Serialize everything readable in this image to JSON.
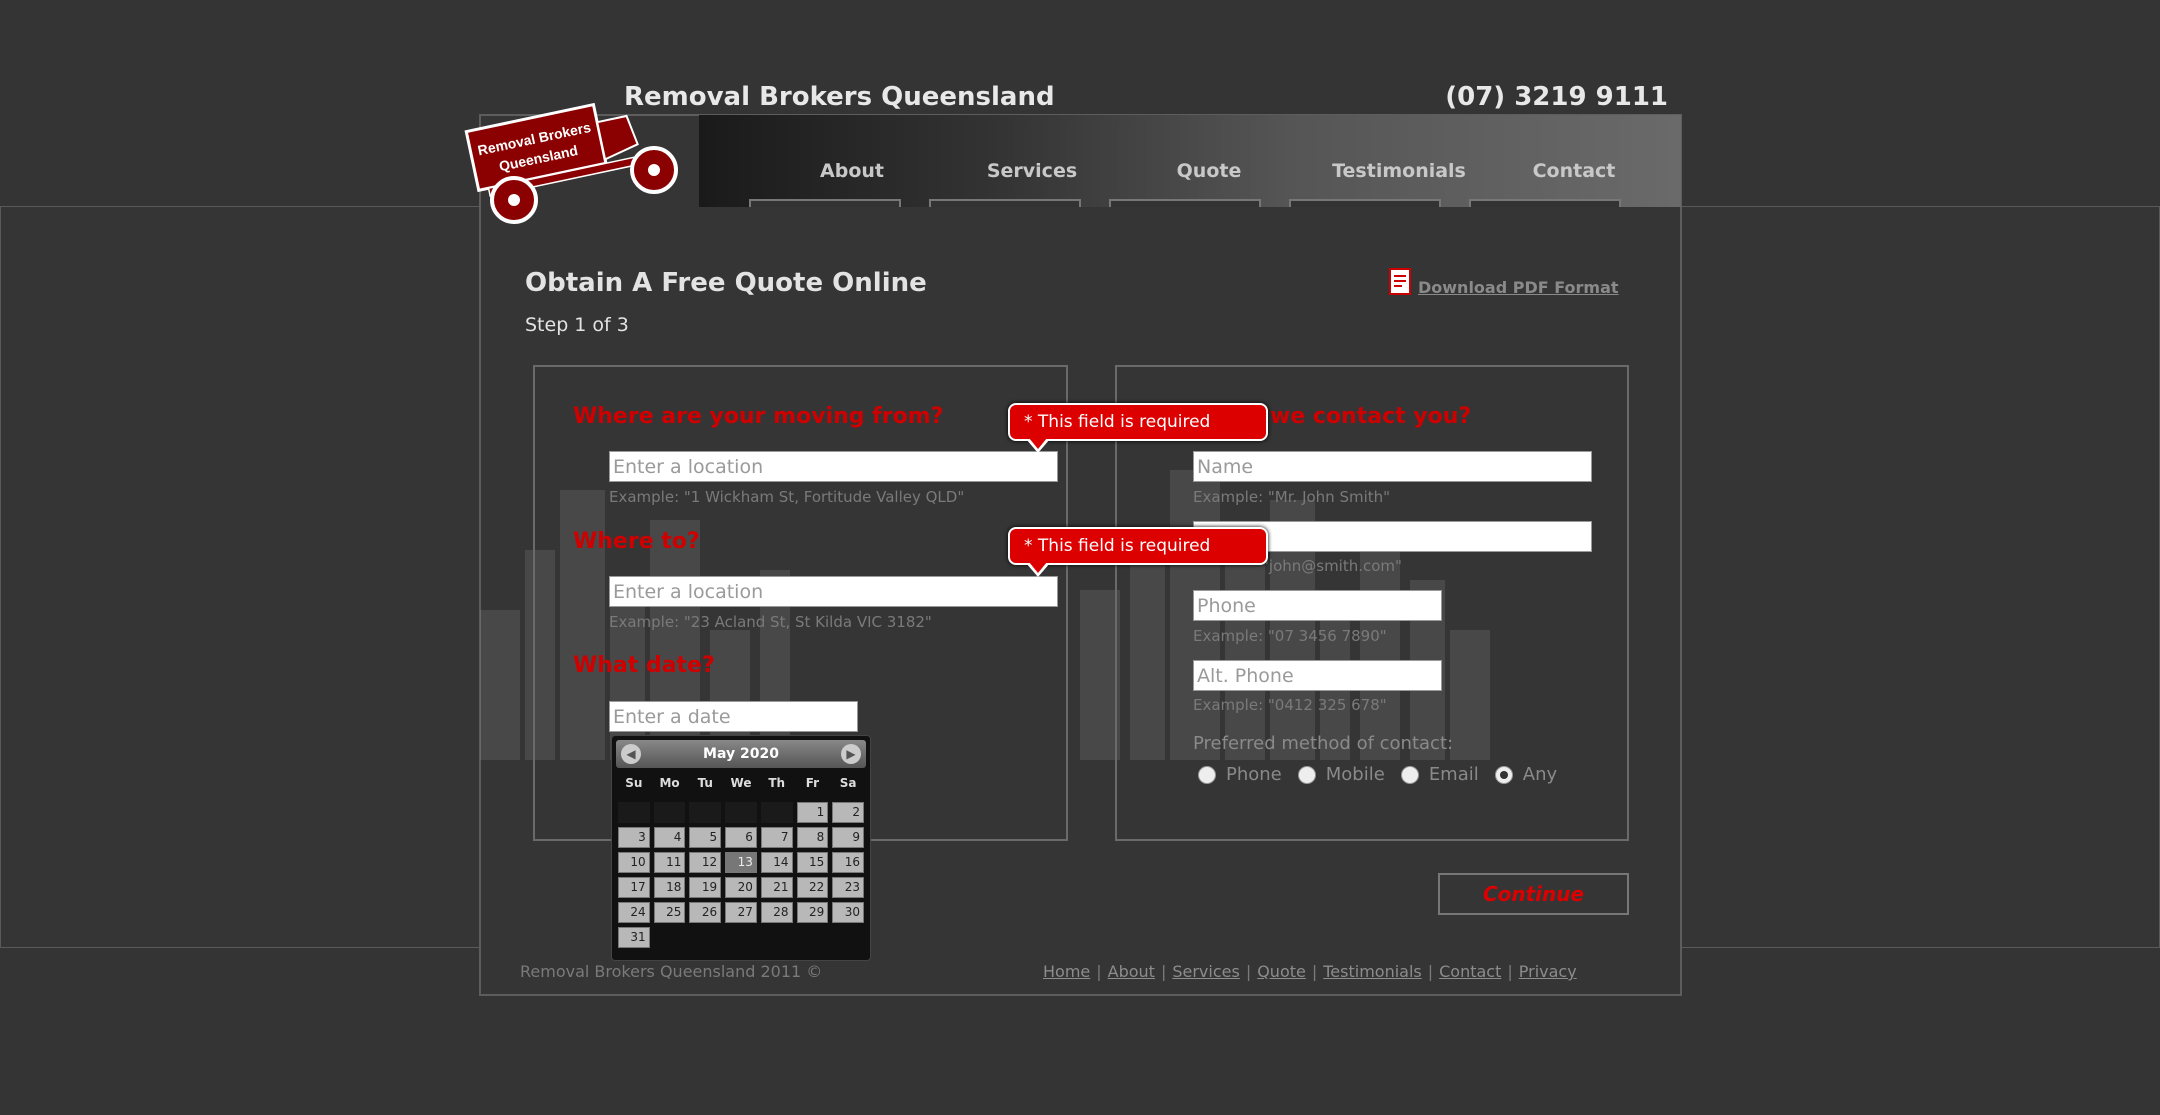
{
  "header": {
    "title": "Removal Brokers Queensland",
    "phone": "(07) 3219 9111",
    "logo_text": "Removal Brokers Queensland"
  },
  "nav": {
    "items": [
      "About",
      "Services",
      "Quote",
      "Testimonials",
      "Contact"
    ]
  },
  "page": {
    "title": "Obtain A Free Quote Online",
    "step": "Step 1 of 3",
    "pdf_link": "Download PDF Format"
  },
  "left": {
    "from_q": "Where are your moving from?",
    "from_placeholder": "Enter a location",
    "from_hint": "Example: \"1 Wickham St, Fortitude Valley QLD\"",
    "to_q": "Where to?",
    "to_placeholder": "Enter a location",
    "to_hint": "Example: \"23 Acland St, St Kilda VIC 3182\"",
    "date_q": "What date?",
    "date_placeholder": "Enter a date"
  },
  "right": {
    "contact_q": "we contact you?",
    "name_placeholder": "Name",
    "name_hint": "Example: \"Mr. John Smith\"",
    "email_hint": "\"john@smith.com\"",
    "phone_placeholder": "Phone",
    "phone_hint": "Example: \"07 3456 7890\"",
    "altphone_placeholder": "Alt. Phone",
    "altphone_hint": "Example: \"0412 325 678\"",
    "pref_label": "Preferred method of contact:",
    "options": [
      "Phone",
      "Mobile",
      "Email",
      "Any"
    ],
    "selected_option": "Any"
  },
  "validation": {
    "message": "* This field is required"
  },
  "continue_label": "Continue",
  "calendar": {
    "month": "May 2020",
    "dow": [
      "Su",
      "Mo",
      "Tu",
      "We",
      "Th",
      "Fr",
      "Sa"
    ],
    "first_weekday": 5,
    "days": 31,
    "today": 13
  },
  "footer": {
    "copyright": "Removal Brokers Queensland 2011 ©",
    "links": [
      "Home",
      "About",
      "Services",
      "Quote",
      "Testimonials",
      "Contact",
      "Privacy"
    ]
  },
  "colors": {
    "accent": "#cc0000",
    "background": "#343434",
    "tooltip": "#dd0000"
  }
}
